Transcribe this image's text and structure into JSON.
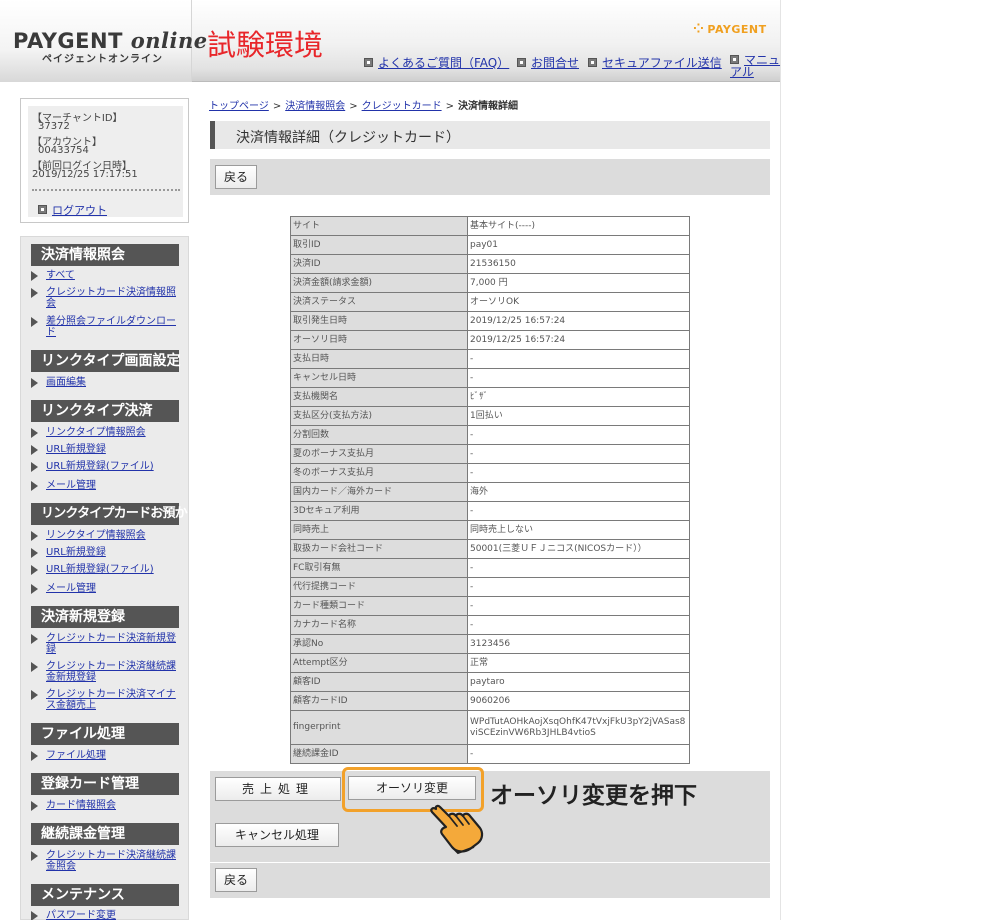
{
  "header": {
    "logo_main": "PAYGENT",
    "logo_online": "online",
    "logo_sub": "ペイジェントオンライン",
    "env_label": "試験環境",
    "brand": "PAYGENT",
    "links": [
      {
        "label": "よくあるご質問（FAQ）"
      },
      {
        "label": "お問合せ"
      },
      {
        "label": "セキュアファイル送信"
      },
      {
        "label": "マニュアル"
      }
    ]
  },
  "account": {
    "merchant_id_label": "【マーチャントID】",
    "merchant_id": "37372",
    "account_label": "【アカウント】",
    "account": "00433754",
    "last_login_label": "【前回ログイン日時】",
    "last_login": "2019/12/25 17:17:51",
    "logout": "ログアウト"
  },
  "menu": {
    "sections": [
      {
        "title": "決済情報照会",
        "items": [
          "すべて",
          "クレジットカード決済情報照会",
          "差分照会ファイルダウンロード"
        ]
      },
      {
        "title": "リンクタイプ画面設定",
        "items": [
          "画面編集"
        ]
      },
      {
        "title": "リンクタイプ決済",
        "items": [
          "リンクタイプ情報照会",
          "URL新規登録",
          "URL新規登録(ファイル)",
          "メール管理"
        ]
      },
      {
        "title": "リンクタイプカードお預かり",
        "items": [
          "リンクタイプ情報照会",
          "URL新規登録",
          "URL新規登録(ファイル)",
          "メール管理"
        ]
      },
      {
        "title": "決済新規登録",
        "items": [
          "クレジットカード決済新規登録",
          "クレジットカード決済継続課金新規登録",
          "クレジットカード決済マイナス金額売上"
        ]
      },
      {
        "title": "ファイル処理",
        "items": [
          "ファイル処理"
        ]
      },
      {
        "title": "登録カード管理",
        "items": [
          "カード情報照会"
        ]
      },
      {
        "title": "継続課金管理",
        "items": [
          "クレジットカード決済継続課金照会"
        ]
      },
      {
        "title": "メンテナンス",
        "items": [
          "パスワード変更"
        ]
      }
    ]
  },
  "breadcrumb": {
    "items": [
      "トップページ",
      "決済情報照会",
      "クレジットカード"
    ],
    "current": "決済情報詳細",
    "separator": ">"
  },
  "page_title": "決済情報詳細（クレジットカード）",
  "buttons": {
    "back": "戻る",
    "sales": "売上処理",
    "auth_change": "オーソリ変更",
    "cancel": "キャンセル処理"
  },
  "annotation": "オーソリ変更を押下",
  "details": [
    {
      "key": "サイト",
      "value": "基本サイト(----)"
    },
    {
      "key": "取引ID",
      "value": "pay01"
    },
    {
      "key": "決済ID",
      "value": "21536150"
    },
    {
      "key": "決済金額(請求金額)",
      "value": "7,000 円"
    },
    {
      "key": "決済ステータス",
      "value": "オーソリOK"
    },
    {
      "key": "取引発生日時",
      "value": "2019/12/25 16:57:24"
    },
    {
      "key": "オーソリ日時",
      "value": "2019/12/25 16:57:24"
    },
    {
      "key": "支払日時",
      "value": "-"
    },
    {
      "key": "キャンセル日時",
      "value": "-"
    },
    {
      "key": "支払機関名",
      "value": "ﾋﾞｻﾞ"
    },
    {
      "key": "支払区分(支払方法)",
      "value": "1回払い"
    },
    {
      "key": "分割回数",
      "value": "-"
    },
    {
      "key": "夏のボーナス支払月",
      "value": "-"
    },
    {
      "key": "冬のボーナス支払月",
      "value": "-"
    },
    {
      "key": "国内カード／海外カード",
      "value": "海外"
    },
    {
      "key": "3Dセキュア利用",
      "value": "-"
    },
    {
      "key": "同時売上",
      "value": "同時売上しない"
    },
    {
      "key": "取扱カード会社コード",
      "value": "50001(三菱ＵＦＪニコス(NICOSカード））"
    },
    {
      "key": "FC取引有無",
      "value": "-"
    },
    {
      "key": "代行提携コード",
      "value": "-"
    },
    {
      "key": "カード種類コード",
      "value": "-"
    },
    {
      "key": "カナカード名称",
      "value": "-"
    },
    {
      "key": "承認No",
      "value": "3123456"
    },
    {
      "key": "Attempt区分",
      "value": "正常"
    },
    {
      "key": "顧客ID",
      "value": "paytaro"
    },
    {
      "key": "顧客カードID",
      "value": "9060206"
    },
    {
      "key": "fingerprint",
      "value": "WPdTutAOHkAojXsqOhfK47tVxjFkU3pY2jVASas8viSCEzinVW6Rb3JHLB4vtioS"
    },
    {
      "key": "継続課金ID",
      "value": "-"
    }
  ]
}
